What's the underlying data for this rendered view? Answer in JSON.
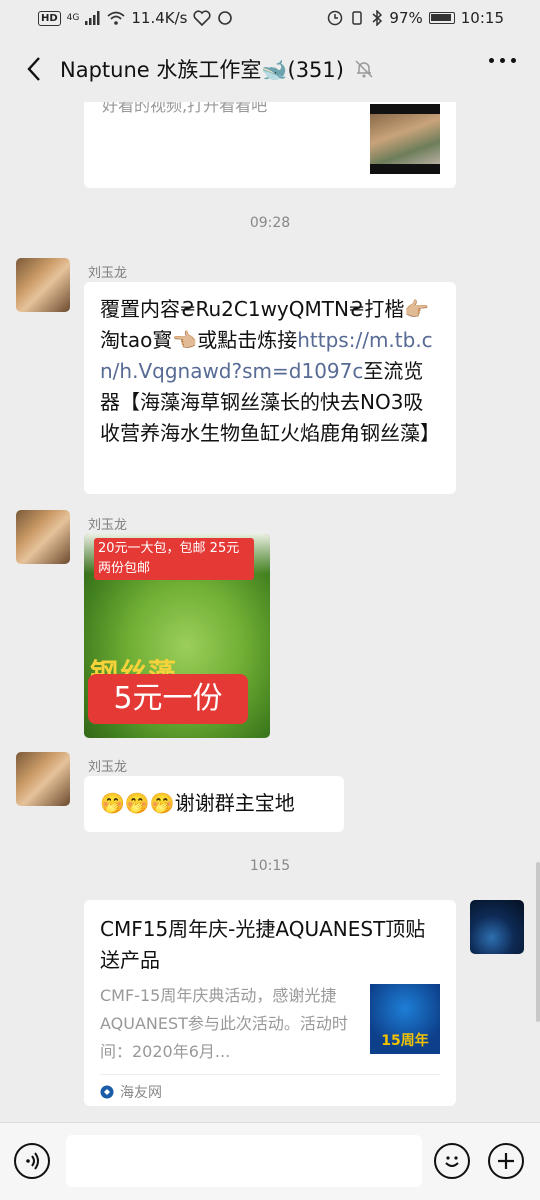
{
  "status_bar": {
    "left_badge": "HD",
    "network": "4G",
    "speed": "11.4K/s",
    "battery": "97%",
    "time": "10:15"
  },
  "header": {
    "title": "Naptune 水族工作室🐋(351)"
  },
  "messages": {
    "top_card": {
      "text": "好看的视频,打开看看吧"
    },
    "time1": "09:28",
    "msg1": {
      "sender": "刘玉龙",
      "part1": "覆置内容₴Ru2C1wyQMTN₴打楷👉🏼淘tao寳👈🏼或點击炼接",
      "link": "https://m.tb.cn/h.Vqgnawd?sm=d1097c",
      "part2": "至流览器【海藻海草钢丝藻长的快去NO3吸收营养海水生物鱼缸火焰鹿角钢丝藻】"
    },
    "msg2": {
      "sender": "刘玉龙",
      "img_top": "20元一大包，包邮 25元两份包邮",
      "img_title": "钢丝藻",
      "img_price": "5元一份"
    },
    "msg3": {
      "sender": "刘玉龙",
      "text": "🤭🤭🤭谢谢群主宝地"
    },
    "time2": "10:15",
    "msg4": {
      "card_title": "CMF15周年庆-光捷AQUANEST顶贴送产品",
      "card_desc": "CMF-15周年庆典活动，感谢光捷AQUANEST参与此次活动。活动时间：2020年6月...",
      "thumb_text": "15周年",
      "source": "海友网"
    }
  },
  "colors": {
    "bg": "#ededed",
    "link": "#576b95",
    "red": "#e53935"
  }
}
